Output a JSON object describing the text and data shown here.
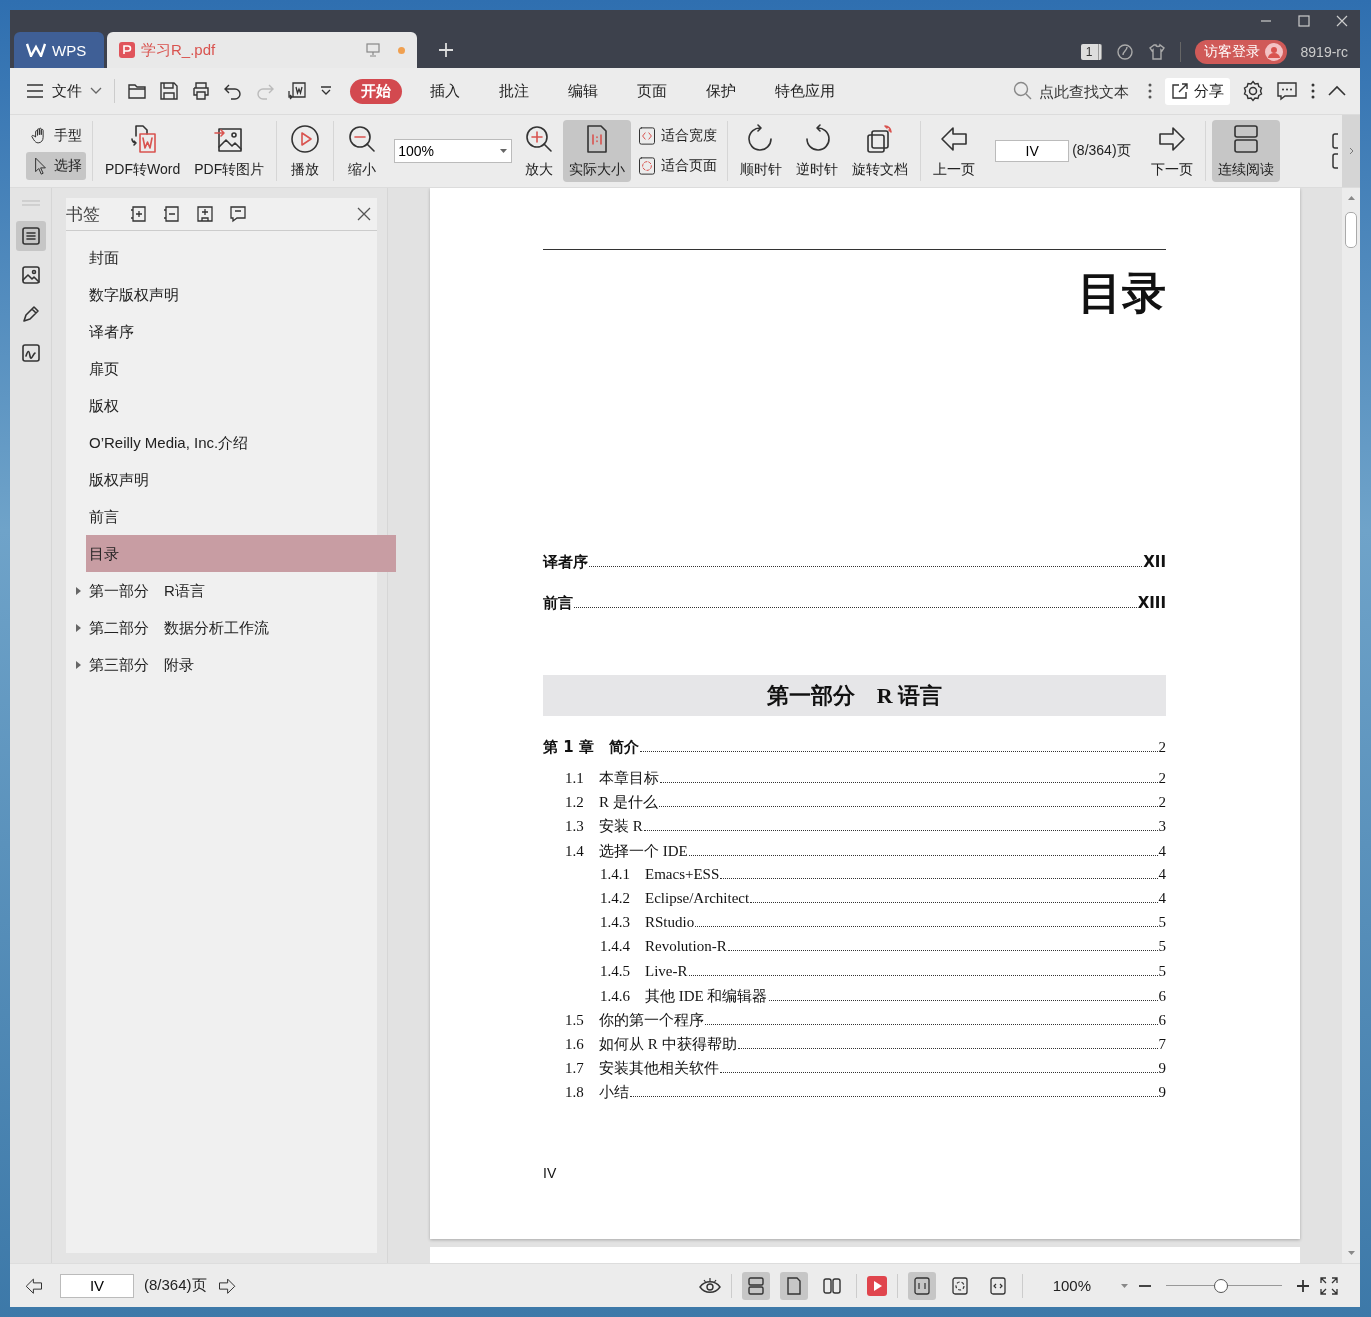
{
  "titlebar": {
    "tabs": [
      {
        "kind": "home",
        "label": "WPS",
        "selected": false
      },
      {
        "kind": "doc",
        "label": "学习R_.pdf",
        "selected": true,
        "modified": true
      }
    ],
    "window_count": "1",
    "login": "访客登录",
    "user": "8919-rc"
  },
  "menu": {
    "file": "文件",
    "tabs": [
      {
        "label": "开始",
        "selected": true
      },
      {
        "label": "插入",
        "selected": false
      },
      {
        "label": "批注",
        "selected": false
      },
      {
        "label": "编辑",
        "selected": false
      },
      {
        "label": "页面",
        "selected": false
      },
      {
        "label": "保护",
        "selected": false
      },
      {
        "label": "特色应用",
        "selected": false
      }
    ],
    "search": {
      "placeholder": "点此查找文本"
    },
    "share": "分享"
  },
  "toolbar": {
    "groups": [
      {
        "items": [
          {
            "kind": "stack",
            "items": [
              {
                "label": "手型",
                "selected": false
              },
              {
                "label": "选择",
                "selected": true
              }
            ]
          }
        ]
      },
      {
        "items": [
          {
            "kind": "big",
            "label": "PDF转Word",
            "selected": false
          },
          {
            "kind": "big",
            "label": "PDF转图片",
            "selected": false
          }
        ]
      },
      {
        "items": [
          {
            "kind": "big",
            "label": "播放",
            "selected": false
          }
        ]
      },
      {
        "items": [
          {
            "kind": "big",
            "label": "缩小",
            "selected": false
          },
          {
            "kind": "zoom-field",
            "value": "100%"
          },
          {
            "kind": "big",
            "label": "放大",
            "selected": false
          },
          {
            "kind": "big",
            "label": "实际大小",
            "selected": true
          },
          {
            "kind": "stack",
            "items": [
              {
                "label": "适合宽度",
                "selected": false
              },
              {
                "label": "适合页面",
                "selected": false
              }
            ]
          }
        ]
      },
      {
        "items": [
          {
            "kind": "big",
            "label": "顺时针",
            "selected": false
          },
          {
            "kind": "big",
            "label": "逆时针",
            "selected": false
          },
          {
            "kind": "big",
            "label": "旋转文档",
            "selected": false
          }
        ]
      },
      {
        "items": [
          {
            "kind": "big",
            "label": "上一页",
            "selected": false
          },
          {
            "kind": "page-field",
            "value": "IV",
            "count": "(8/364)页"
          },
          {
            "kind": "big",
            "label": "下一页",
            "selected": false
          }
        ]
      },
      {
        "items": [
          {
            "kind": "big",
            "label": "连续阅读",
            "selected": true
          }
        ]
      }
    ]
  },
  "sidebar": {
    "strip": [
      {
        "selected": true
      },
      {
        "selected": false
      },
      {
        "selected": false
      },
      {
        "selected": false
      }
    ]
  },
  "bookmarks": {
    "title": "书签",
    "items": [
      {
        "label": "封面",
        "selected": false
      },
      {
        "label": "数字版权声明",
        "selected": false
      },
      {
        "label": "译者序",
        "selected": false
      },
      {
        "label": "扉页",
        "selected": false
      },
      {
        "label": "版权",
        "selected": false
      },
      {
        "label": "O’Reilly Media, Inc.介绍",
        "selected": false
      },
      {
        "label": "版权声明",
        "selected": false
      },
      {
        "label": "前言",
        "selected": false
      },
      {
        "label": "目录",
        "selected": true
      },
      {
        "label": "第一部分　R语言",
        "selected": false,
        "expanded": false
      },
      {
        "label": "第二部分　数据分析工作流",
        "selected": false,
        "expanded": false
      },
      {
        "label": "第三部分　附录",
        "selected": false,
        "expanded": false
      }
    ]
  },
  "document": {
    "page": {
      "title": "目录",
      "footer": "IV",
      "toc": [
        {
          "kind": "front",
          "title": "译者序",
          "page": "XII"
        },
        {
          "kind": "front",
          "title": "前言",
          "page": "XIII"
        },
        {
          "kind": "part",
          "title": "第一部分　R 语言"
        },
        {
          "kind": "chapter",
          "title": "第 1 章　简介",
          "page": "2",
          "children": [
            {
              "number": "1.1",
              "title": "本章目标",
              "page": "2"
            },
            {
              "number": "1.2",
              "title": "R 是什么",
              "page": "2"
            },
            {
              "number": "1.3",
              "title": "安装 R",
              "page": "3"
            },
            {
              "number": "1.4",
              "title": "选择一个 IDE",
              "page": "4",
              "children": [
                {
                  "number": "1.4.1",
                  "title": "Emacs+ESS",
                  "page": "4"
                },
                {
                  "number": "1.4.2",
                  "title": "Eclipse/Architect",
                  "page": "4"
                },
                {
                  "number": "1.4.3",
                  "title": "RStudio",
                  "page": "5"
                },
                {
                  "number": "1.4.4",
                  "title": "Revolution-R",
                  "page": "5"
                },
                {
                  "number": "1.4.5",
                  "title": "Live-R",
                  "page": "5"
                },
                {
                  "number": "1.4.6",
                  "title": "其他 IDE 和编辑器",
                  "page": "6"
                }
              ]
            },
            {
              "number": "1.5",
              "title": "你的第一个程序",
              "page": "6"
            },
            {
              "number": "1.6",
              "title": "如何从 R 中获得帮助",
              "page": "7"
            },
            {
              "number": "1.7",
              "title": "安装其他相关软件",
              "page": "9"
            },
            {
              "number": "1.8",
              "title": "小结",
              "page": "9"
            }
          ]
        }
      ]
    }
  },
  "status_bar": {
    "page": "IV",
    "page_count": "(8/364)页",
    "views": [
      {
        "selected": true
      },
      {
        "selected": true
      },
      {
        "selected": false
      }
    ],
    "fits": [
      {
        "selected": true
      },
      {
        "selected": false
      },
      {
        "selected": false
      }
    ],
    "zoom": "100%",
    "level": 0.47
  }
}
